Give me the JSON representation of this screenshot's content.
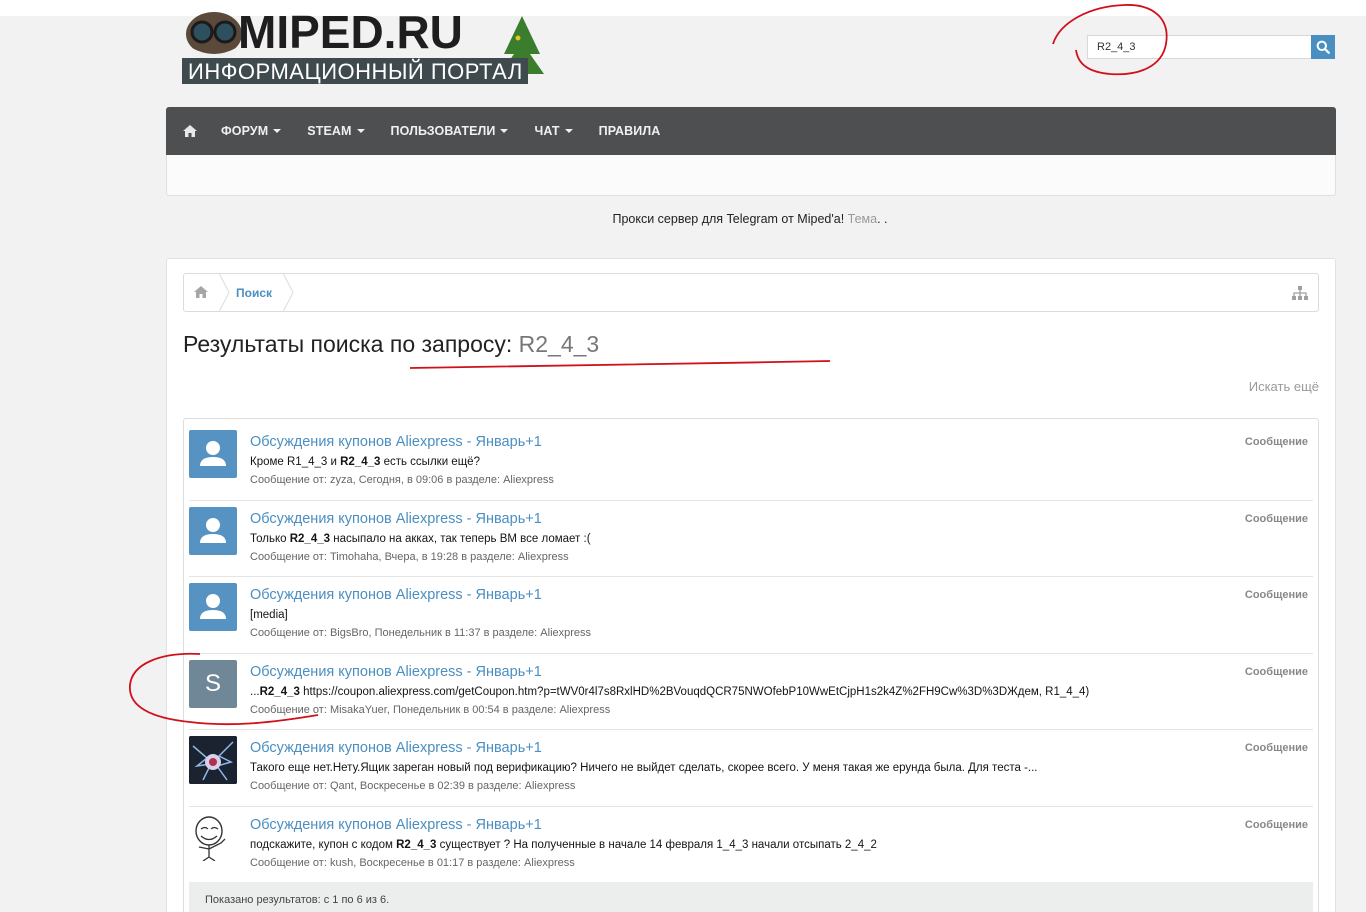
{
  "search": {
    "value": "R2_4_3"
  },
  "logo": {
    "title": "MIPED.RU",
    "subtitle": "ИНФОРМАЦИОННЫЙ ПОРТАЛ"
  },
  "nav": {
    "items": [
      {
        "label": "ФОРУМ",
        "dropdown": true
      },
      {
        "label": "STEAM",
        "dropdown": true
      },
      {
        "label": "ПОЛЬЗОВАТЕЛИ",
        "dropdown": true
      },
      {
        "label": "ЧАТ",
        "dropdown": true
      },
      {
        "label": "ПРАВИЛА",
        "dropdown": false
      }
    ]
  },
  "notice": {
    "text": "Прокси сервер для Telegram от Miped'a! ",
    "tema": "Тема",
    "suffix": ". ."
  },
  "breadcrumb": {
    "current": "Поиск"
  },
  "page": {
    "title_prefix": "Результаты поиска по запросу: ",
    "query": "R2_4_3",
    "more_link": "Искать ещё"
  },
  "results": [
    {
      "title": "Обсуждения купонов Aliexpress - Январь+1",
      "snippet_before": "Кроме R1_4_3 и ",
      "snippet_bold": "R2_4_3",
      "snippet_after": " есть ссылки ещё?",
      "meta_prefix": "Сообщение от: ",
      "author": "zyza",
      "date": ", Сегодня, в 09:06",
      "meta_section_prefix": " в разделе: ",
      "section": "Aliexpress",
      "type": "Сообщение",
      "avatar": "default"
    },
    {
      "title": "Обсуждения купонов Aliexpress - Январь+1",
      "snippet_before": "Только ",
      "snippet_bold": "R2_4_3",
      "snippet_after": " насыпало на акках, так теперь ВМ все ломает :(",
      "meta_prefix": "Сообщение от: ",
      "author": "Timohaha",
      "date": ", Вчера, в 19:28",
      "meta_section_prefix": " в разделе: ",
      "section": "Aliexpress",
      "type": "Сообщение",
      "avatar": "default"
    },
    {
      "title": "Обсуждения купонов Aliexpress - Январь+1",
      "snippet_before": "[media]",
      "snippet_bold": "",
      "snippet_after": "",
      "meta_prefix": "Сообщение от: ",
      "author": "BigsBro",
      "date": ", Понедельник в 11:37",
      "meta_section_prefix": " в разделе: ",
      "section": "Aliexpress",
      "type": "Сообщение",
      "avatar": "default"
    },
    {
      "title": "Обсуждения купонов Aliexpress - Январь+1",
      "snippet_before": "...",
      "snippet_bold": "R2_4_3",
      "snippet_after": " https://coupon.aliexpress.com/getCoupon.htm?p=tWV0r4l7s8RxlHD%2BVouqdQCR75NWOfebP10WwEtCjpH1s2k4Z%2FH9Cw%3D%3DЖдем, R1_4_4)",
      "meta_prefix": "Сообщение от: ",
      "author": "MisakaYuer",
      "date": ", Понедельник в 00:54",
      "meta_section_prefix": " в разделе: ",
      "section": "Aliexpress",
      "type": "Сообщение",
      "avatar": "letter",
      "avatar_letter": "S"
    },
    {
      "title": "Обсуждения купонов Aliexpress - Январь+1",
      "snippet_before": "Такого еще нет.Нету.Ящик зареган новый под верификацию? Ничего не выйдет сделать, скорее всего. У меня такая же ерунда была. Для теста -...",
      "snippet_bold": "",
      "snippet_after": "",
      "meta_prefix": "Сообщение от: ",
      "author": "Qant",
      "date": ", Воскресенье в 02:39",
      "meta_section_prefix": " в разделе: ",
      "section": "Aliexpress",
      "type": "Сообщение",
      "avatar": "image-dark"
    },
    {
      "title": "Обсуждения купонов Aliexpress - Январь+1",
      "snippet_before": "подскажите, купон с кодом ",
      "snippet_bold": "R2_4_3",
      "snippet_after": " существует ? На полученные в начале 14 февраля 1_4_3 начали отсыпать 2_4_2",
      "meta_prefix": "Сообщение от: ",
      "author": "kush",
      "date": ", Воскресенье в 01:17",
      "meta_section_prefix": " в разделе: ",
      "section": "Aliexpress",
      "type": "Сообщение",
      "avatar": "image-meme"
    }
  ],
  "footer": {
    "text": "Показано результатов: с 1 по 6 из 6."
  },
  "colors": {
    "accent": "#4a8fc1",
    "navbar": "#4d4f51",
    "annotation": "#d0101a"
  }
}
